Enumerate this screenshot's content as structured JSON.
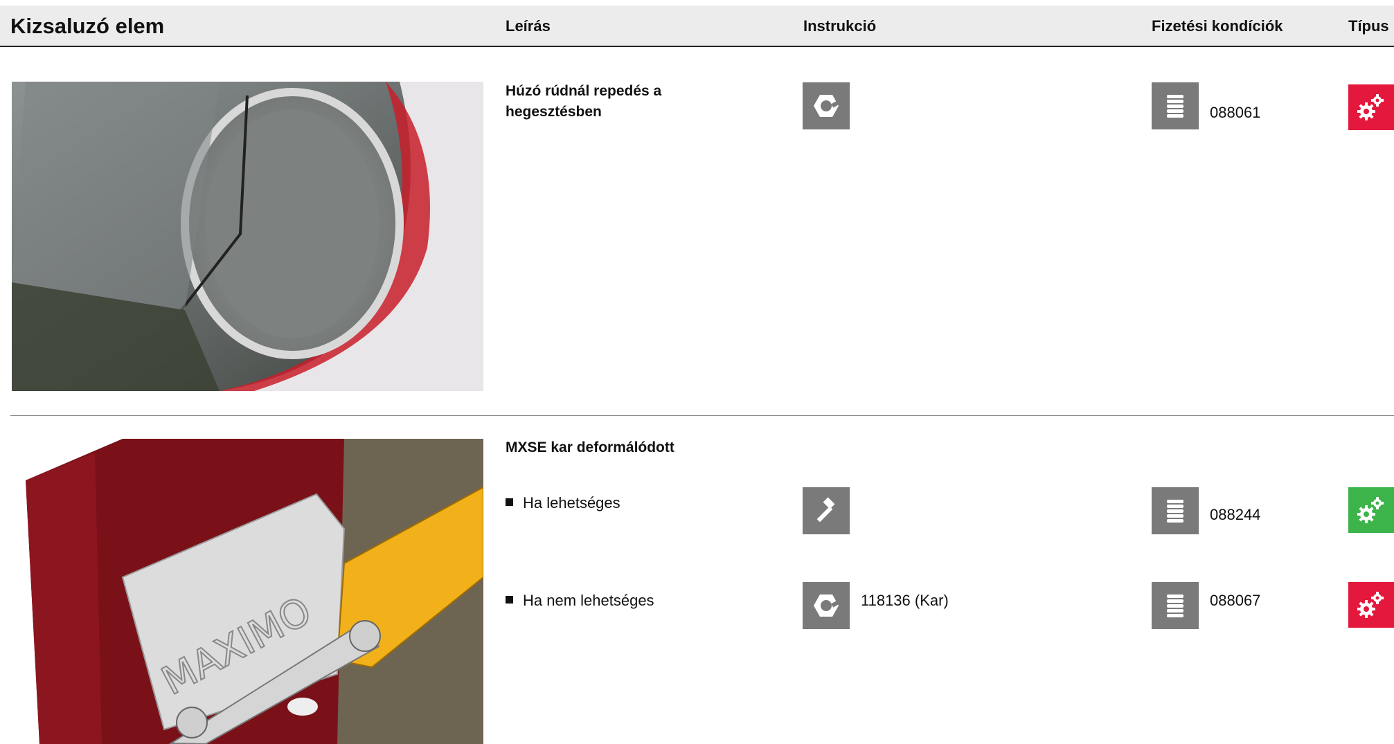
{
  "header": {
    "title": "Kizsaluzó elem",
    "col_description": "Leírás",
    "col_instruction": "Instrukció",
    "col_payment": "Fizetési kondíciók",
    "col_type": "Típus"
  },
  "rows": [
    {
      "description": "Húzó rúdnál repedés a hegesztésben",
      "instruction_icon": "hex-nut-icon",
      "payment_icon": "coin-stack-icon",
      "payment_code": "088061",
      "type_icon": "gears-icon",
      "type_color": "#e3183c"
    },
    {
      "description": "MXSE kar deformálódott",
      "options": [
        {
          "label": "Ha lehetséges",
          "instruction_icon": "hammer-icon",
          "instruction_text": "",
          "payment_icon": "coin-stack-icon",
          "payment_code": "088244",
          "type_icon": "gears-icon",
          "type_color": "#3cb44a"
        },
        {
          "label": "Ha nem lehetséges",
          "instruction_icon": "hex-nut-icon",
          "instruction_text": "118136 (Kar)",
          "payment_icon": "coin-stack-icon",
          "payment_code": "088067",
          "type_icon": "gears-icon",
          "type_color": "#e3183c"
        }
      ]
    }
  ],
  "photo2_text": "MAXIMO",
  "colors": {
    "icon_bg": "#7a7a7a",
    "header_bg": "#ececec"
  }
}
